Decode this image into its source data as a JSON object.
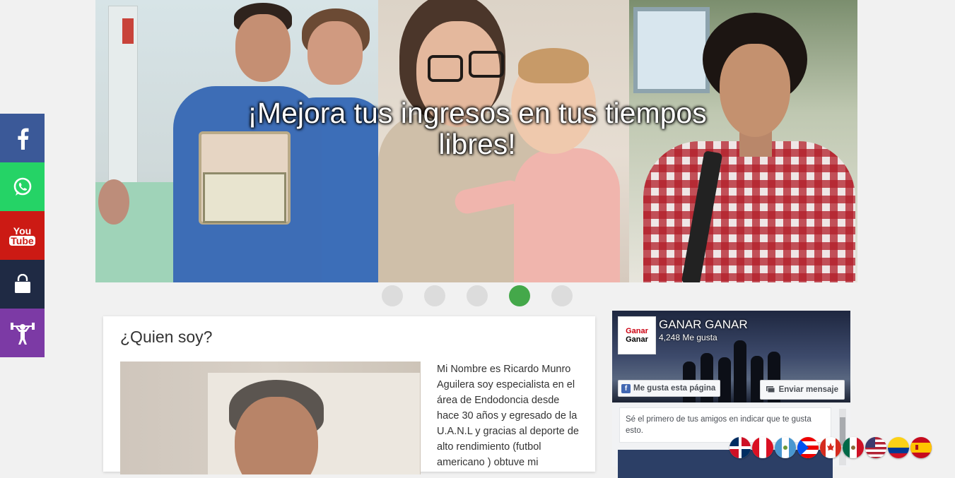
{
  "hero": {
    "title": "¡Mejora tus ingresos en tus tiempos libres!",
    "slides_total": 5,
    "active_slide": 4
  },
  "social": [
    {
      "name": "facebook",
      "color": "#3b5998"
    },
    {
      "name": "whatsapp",
      "color": "#25d366"
    },
    {
      "name": "youtube",
      "color": "#cc1a14",
      "icon_text": [
        "You",
        "Tube"
      ]
    },
    {
      "name": "shop",
      "color": "#1f2a44"
    },
    {
      "name": "fitness",
      "color": "#7c3aa5"
    }
  ],
  "about": {
    "heading": "¿Quien soy?",
    "text": "Mi Nombre es Ricardo Munro Aguilera soy especialista en el área de Endodoncia desde hace 30 años y egresado de la U.A.N.L y gracias al deporte de alto rendimiento (futbol americano ) obtuve mi"
  },
  "facebook_widget": {
    "page_name": "GANAR GANAR",
    "likes": "4,248 Me gusta",
    "like_button": "Me gusta esta página",
    "message_button": "Enviar mensaje",
    "friends_note": "Sé el primero de tus amigos en indicar que te gusta esto.",
    "logo_text": [
      "Ganar",
      "Ganar"
    ]
  },
  "flags": [
    "dominican-republic",
    "peru",
    "guatemala",
    "puerto-rico",
    "canada",
    "mexico",
    "usa",
    "colombia",
    "spain"
  ],
  "colors": {
    "active_dot": "#44a84a",
    "inactive_dot": "#dcdcdc",
    "page_bg": "#f1f1f1"
  }
}
